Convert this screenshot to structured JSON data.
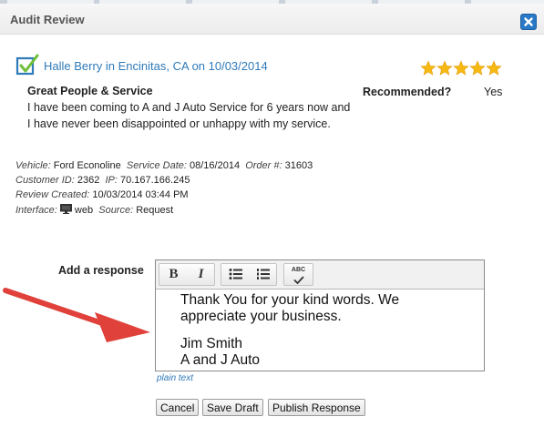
{
  "dialog": {
    "title": "Audit Review",
    "close_icon": "close-icon"
  },
  "review": {
    "headline": "Halle Berry in Encinitas, CA on 10/03/2014",
    "rating": 5,
    "rating_max": 5,
    "title": "Great People & Service",
    "body": "I have been coming to A and J Auto Service for 6 years now and I have never been disappointed or unhappy with my service.",
    "recommended_label": "Recommended?",
    "recommended_value": "Yes"
  },
  "details": {
    "vehicle_label": "Vehicle:",
    "vehicle": "Ford Econoline",
    "service_date_label": "Service Date:",
    "service_date": "08/16/2014",
    "order_label": "Order #:",
    "order": "31603",
    "customer_id_label": "Customer ID:",
    "customer_id": "2362",
    "ip_label": "IP:",
    "ip": "70.167.166.245",
    "review_created_label": "Review Created:",
    "review_created": "10/03/2014 03:44 PM",
    "interface_label": "Interface:",
    "interface": "web",
    "source_label": "Source:",
    "source": "Request"
  },
  "response": {
    "label": "Add a response",
    "toolbar": {
      "bold": "B",
      "italic": "I",
      "spellcheck_text": "ABC"
    },
    "lines": [
      "Thank You for your kind words. We",
      "appreciate your business."
    ],
    "signature": [
      "Jim Smith",
      "A and J Auto"
    ],
    "plain_text_link": "plain text"
  },
  "buttons": {
    "cancel": "Cancel",
    "save_draft": "Save Draft",
    "publish": "Publish Response"
  },
  "colors": {
    "link": "#2f7ab9",
    "star": "#f6b913",
    "close": "#2a79c7",
    "arrow": "#e0423b"
  }
}
